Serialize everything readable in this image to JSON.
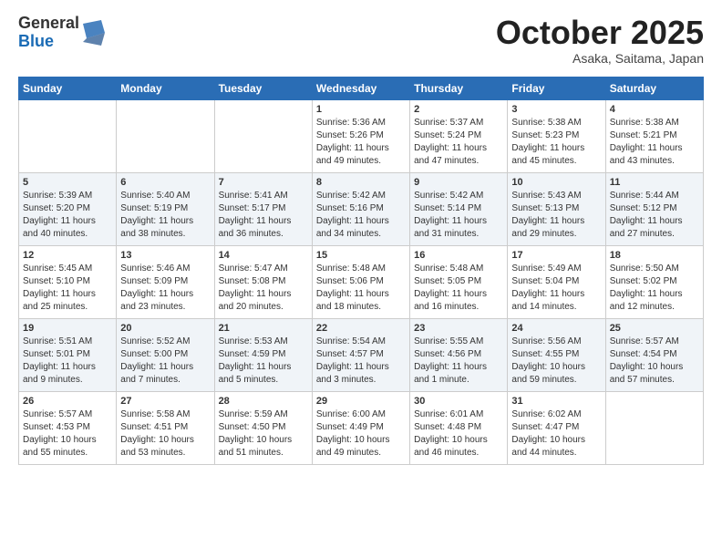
{
  "header": {
    "logo_general": "General",
    "logo_blue": "Blue",
    "month_title": "October 2025",
    "location": "Asaka, Saitama, Japan"
  },
  "weekdays": [
    "Sunday",
    "Monday",
    "Tuesday",
    "Wednesday",
    "Thursday",
    "Friday",
    "Saturday"
  ],
  "weeks": [
    [
      {
        "day": "",
        "sunrise": "",
        "sunset": "",
        "daylight": ""
      },
      {
        "day": "",
        "sunrise": "",
        "sunset": "",
        "daylight": ""
      },
      {
        "day": "",
        "sunrise": "",
        "sunset": "",
        "daylight": ""
      },
      {
        "day": "1",
        "sunrise": "Sunrise: 5:36 AM",
        "sunset": "Sunset: 5:26 PM",
        "daylight": "Daylight: 11 hours and 49 minutes."
      },
      {
        "day": "2",
        "sunrise": "Sunrise: 5:37 AM",
        "sunset": "Sunset: 5:24 PM",
        "daylight": "Daylight: 11 hours and 47 minutes."
      },
      {
        "day": "3",
        "sunrise": "Sunrise: 5:38 AM",
        "sunset": "Sunset: 5:23 PM",
        "daylight": "Daylight: 11 hours and 45 minutes."
      },
      {
        "day": "4",
        "sunrise": "Sunrise: 5:38 AM",
        "sunset": "Sunset: 5:21 PM",
        "daylight": "Daylight: 11 hours and 43 minutes."
      }
    ],
    [
      {
        "day": "5",
        "sunrise": "Sunrise: 5:39 AM",
        "sunset": "Sunset: 5:20 PM",
        "daylight": "Daylight: 11 hours and 40 minutes."
      },
      {
        "day": "6",
        "sunrise": "Sunrise: 5:40 AM",
        "sunset": "Sunset: 5:19 PM",
        "daylight": "Daylight: 11 hours and 38 minutes."
      },
      {
        "day": "7",
        "sunrise": "Sunrise: 5:41 AM",
        "sunset": "Sunset: 5:17 PM",
        "daylight": "Daylight: 11 hours and 36 minutes."
      },
      {
        "day": "8",
        "sunrise": "Sunrise: 5:42 AM",
        "sunset": "Sunset: 5:16 PM",
        "daylight": "Daylight: 11 hours and 34 minutes."
      },
      {
        "day": "9",
        "sunrise": "Sunrise: 5:42 AM",
        "sunset": "Sunset: 5:14 PM",
        "daylight": "Daylight: 11 hours and 31 minutes."
      },
      {
        "day": "10",
        "sunrise": "Sunrise: 5:43 AM",
        "sunset": "Sunset: 5:13 PM",
        "daylight": "Daylight: 11 hours and 29 minutes."
      },
      {
        "day": "11",
        "sunrise": "Sunrise: 5:44 AM",
        "sunset": "Sunset: 5:12 PM",
        "daylight": "Daylight: 11 hours and 27 minutes."
      }
    ],
    [
      {
        "day": "12",
        "sunrise": "Sunrise: 5:45 AM",
        "sunset": "Sunset: 5:10 PM",
        "daylight": "Daylight: 11 hours and 25 minutes."
      },
      {
        "day": "13",
        "sunrise": "Sunrise: 5:46 AM",
        "sunset": "Sunset: 5:09 PM",
        "daylight": "Daylight: 11 hours and 23 minutes."
      },
      {
        "day": "14",
        "sunrise": "Sunrise: 5:47 AM",
        "sunset": "Sunset: 5:08 PM",
        "daylight": "Daylight: 11 hours and 20 minutes."
      },
      {
        "day": "15",
        "sunrise": "Sunrise: 5:48 AM",
        "sunset": "Sunset: 5:06 PM",
        "daylight": "Daylight: 11 hours and 18 minutes."
      },
      {
        "day": "16",
        "sunrise": "Sunrise: 5:48 AM",
        "sunset": "Sunset: 5:05 PM",
        "daylight": "Daylight: 11 hours and 16 minutes."
      },
      {
        "day": "17",
        "sunrise": "Sunrise: 5:49 AM",
        "sunset": "Sunset: 5:04 PM",
        "daylight": "Daylight: 11 hours and 14 minutes."
      },
      {
        "day": "18",
        "sunrise": "Sunrise: 5:50 AM",
        "sunset": "Sunset: 5:02 PM",
        "daylight": "Daylight: 11 hours and 12 minutes."
      }
    ],
    [
      {
        "day": "19",
        "sunrise": "Sunrise: 5:51 AM",
        "sunset": "Sunset: 5:01 PM",
        "daylight": "Daylight: 11 hours and 9 minutes."
      },
      {
        "day": "20",
        "sunrise": "Sunrise: 5:52 AM",
        "sunset": "Sunset: 5:00 PM",
        "daylight": "Daylight: 11 hours and 7 minutes."
      },
      {
        "day": "21",
        "sunrise": "Sunrise: 5:53 AM",
        "sunset": "Sunset: 4:59 PM",
        "daylight": "Daylight: 11 hours and 5 minutes."
      },
      {
        "day": "22",
        "sunrise": "Sunrise: 5:54 AM",
        "sunset": "Sunset: 4:57 PM",
        "daylight": "Daylight: 11 hours and 3 minutes."
      },
      {
        "day": "23",
        "sunrise": "Sunrise: 5:55 AM",
        "sunset": "Sunset: 4:56 PM",
        "daylight": "Daylight: 11 hours and 1 minute."
      },
      {
        "day": "24",
        "sunrise": "Sunrise: 5:56 AM",
        "sunset": "Sunset: 4:55 PM",
        "daylight": "Daylight: 10 hours and 59 minutes."
      },
      {
        "day": "25",
        "sunrise": "Sunrise: 5:57 AM",
        "sunset": "Sunset: 4:54 PM",
        "daylight": "Daylight: 10 hours and 57 minutes."
      }
    ],
    [
      {
        "day": "26",
        "sunrise": "Sunrise: 5:57 AM",
        "sunset": "Sunset: 4:53 PM",
        "daylight": "Daylight: 10 hours and 55 minutes."
      },
      {
        "day": "27",
        "sunrise": "Sunrise: 5:58 AM",
        "sunset": "Sunset: 4:51 PM",
        "daylight": "Daylight: 10 hours and 53 minutes."
      },
      {
        "day": "28",
        "sunrise": "Sunrise: 5:59 AM",
        "sunset": "Sunset: 4:50 PM",
        "daylight": "Daylight: 10 hours and 51 minutes."
      },
      {
        "day": "29",
        "sunrise": "Sunrise: 6:00 AM",
        "sunset": "Sunset: 4:49 PM",
        "daylight": "Daylight: 10 hours and 49 minutes."
      },
      {
        "day": "30",
        "sunrise": "Sunrise: 6:01 AM",
        "sunset": "Sunset: 4:48 PM",
        "daylight": "Daylight: 10 hours and 46 minutes."
      },
      {
        "day": "31",
        "sunrise": "Sunrise: 6:02 AM",
        "sunset": "Sunset: 4:47 PM",
        "daylight": "Daylight: 10 hours and 44 minutes."
      },
      {
        "day": "",
        "sunrise": "",
        "sunset": "",
        "daylight": ""
      }
    ]
  ]
}
